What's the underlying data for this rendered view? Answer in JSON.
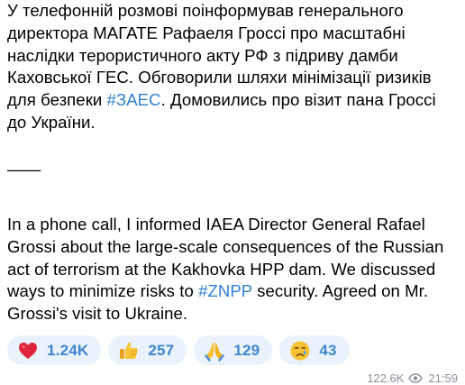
{
  "message": {
    "ukrainian": {
      "before_hashtag": "У телефонній розмові поінформував генерального директора МАГАТЕ Рафаеля Гроссі про масштабні наслідки терористичного акту РФ з підриву дамби Каховської ГЕС. Обговорили шляхи мінімізації ризиків для безпеки ",
      "hashtag": "#ЗАЕС",
      "after_hashtag": ". Домовились про візит пана Гроссі до України."
    },
    "separator": "——",
    "english": {
      "before_hashtag": "In a phone call, I informed IAEA Director General Rafael Grossi about the large-scale consequences of the Russian act of terrorism at the Kakhovka HPP dam. We discussed ways to minimize risks to ",
      "hashtag": "#ZNPP",
      "after_hashtag": " security. Agreed on Mr. Grossi's visit to Ukraine."
    }
  },
  "reactions": [
    {
      "emoji": "heart-icon",
      "count": "1.24K"
    },
    {
      "emoji": "thumbs-up-icon",
      "count": "257"
    },
    {
      "emoji": "folded-hands-icon",
      "count": "129"
    },
    {
      "emoji": "crying-face-icon",
      "count": "43"
    }
  ],
  "meta": {
    "views": "122.6K",
    "time": "21:59"
  },
  "colors": {
    "hashtag": "#2f81d0",
    "reaction_bg": "#eaf2fb",
    "reaction_count": "#3d86cf",
    "meta": "#8a8f96"
  }
}
